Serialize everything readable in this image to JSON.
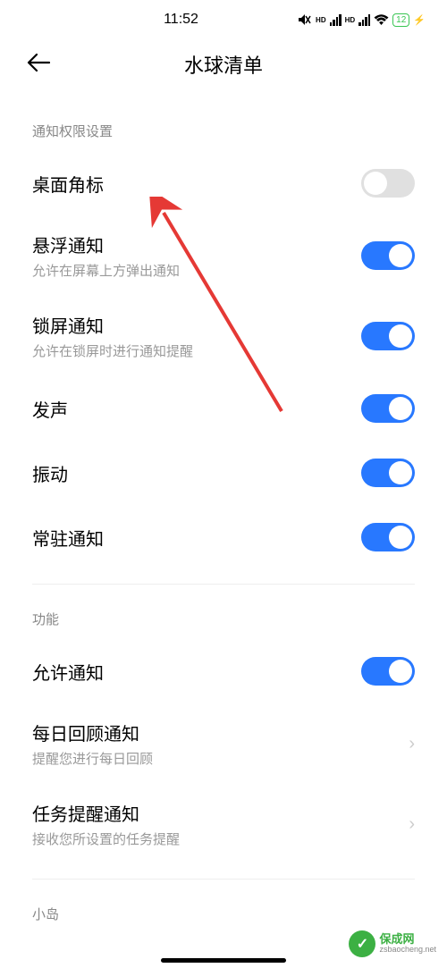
{
  "status_bar": {
    "time": "11:52",
    "battery": "12"
  },
  "header": {
    "title": "水球清单"
  },
  "sections": {
    "notification_perm": {
      "header": "通知权限设置",
      "items": {
        "desktop_badge": {
          "title": "桌面角标"
        },
        "floating": {
          "title": "悬浮通知",
          "subtitle": "允许在屏幕上方弹出通知"
        },
        "lockscreen": {
          "title": "锁屏通知",
          "subtitle": "允许在锁屏时进行通知提醒"
        },
        "sound": {
          "title": "发声"
        },
        "vibrate": {
          "title": "振动"
        },
        "persistent": {
          "title": "常驻通知"
        }
      }
    },
    "feature": {
      "header": "功能",
      "items": {
        "allow_notify": {
          "title": "允许通知"
        },
        "daily_review": {
          "title": "每日回顾通知",
          "subtitle": "提醒您进行每日回顾"
        },
        "task_reminder": {
          "title": "任务提醒通知",
          "subtitle": "接收您所设置的任务提醒"
        }
      }
    },
    "island": {
      "header": "小岛"
    }
  },
  "watermark": {
    "name": "保成网",
    "url": "zsbaocheng.net"
  }
}
